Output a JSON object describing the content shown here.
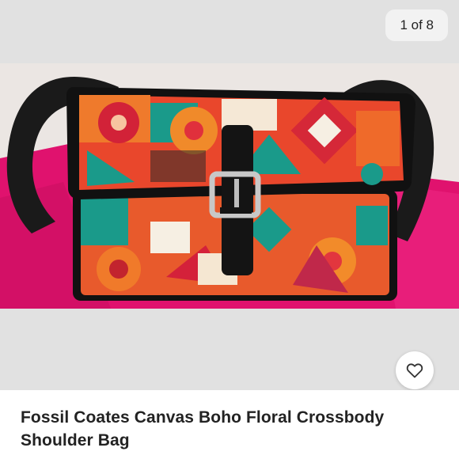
{
  "gallery": {
    "counter": "1 of 8"
  },
  "product": {
    "title": "Fossil Coates Canvas Boho Floral Crossbody Shoulder Bag",
    "image_alt": "Fossil Coates Canvas Boho Floral Crossbody Shoulder Bag"
  },
  "icons": {
    "like": "heart-icon"
  },
  "colors": {
    "gallery_bg": "#e1e1e1",
    "counter_bg": "#f2f2f2",
    "text": "#222222"
  }
}
